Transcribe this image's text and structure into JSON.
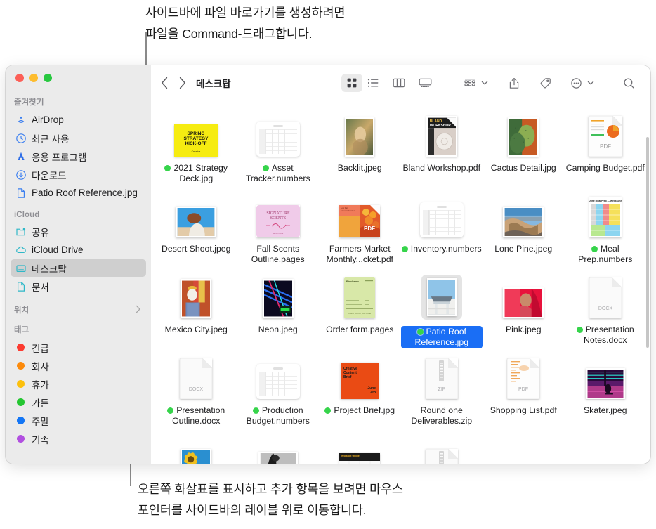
{
  "callouts": {
    "top": "사이드바에 파일 바로가기를 생성하려면\n파일을 Command-드래그합니다.",
    "bottom": "오른쪽 화살표를 표시하고 추가 항목을 보려면 마우스\n포인터를 사이드바의 레이블 위로 이동합니다."
  },
  "window": {
    "traffic_lights": [
      "close",
      "minimize",
      "zoom"
    ],
    "colors": {
      "close": "#fc5f57",
      "minimize": "#fdbc2e",
      "zoom": "#28c840",
      "selection": "#1a6ef5",
      "tag_green": "#36d44b"
    }
  },
  "toolbar": {
    "back_label": "뒤로",
    "forward_label": "앞으로",
    "title": "데스크탑",
    "views": [
      {
        "name": "icon-view",
        "label": "아이콘 보기",
        "active": true
      },
      {
        "name": "list-view",
        "label": "목록 보기",
        "active": false
      },
      {
        "name": "column-view",
        "label": "열 보기",
        "active": false
      },
      {
        "name": "gallery-view",
        "label": "갤러리 보기",
        "active": false
      }
    ],
    "group_label": "그룹 사용",
    "share_label": "공유",
    "tags_label": "태그",
    "more_label": "추가 작업",
    "search_label": "검색"
  },
  "sidebar": {
    "sections": [
      {
        "header": "즐겨찾기",
        "has_chevron": false,
        "items": [
          {
            "label": "AirDrop",
            "icon": "airdrop-icon",
            "selected": false
          },
          {
            "label": "최근 사용",
            "icon": "clock-icon",
            "selected": false
          },
          {
            "label": "응용 프로그램",
            "icon": "applications-icon",
            "selected": false
          },
          {
            "label": "다운로드",
            "icon": "downloads-icon",
            "selected": false
          },
          {
            "label": "Patio Roof Reference.jpg",
            "icon": "document-icon",
            "selected": false
          }
        ]
      },
      {
        "header": "iCloud",
        "has_chevron": false,
        "items": [
          {
            "label": "공유",
            "icon": "shared-folder-icon",
            "selected": false
          },
          {
            "label": "iCloud Drive",
            "icon": "cloud-icon",
            "selected": false
          },
          {
            "label": "데스크탑",
            "icon": "desktop-icon",
            "selected": true
          },
          {
            "label": "문서",
            "icon": "document-icon",
            "selected": false
          }
        ]
      },
      {
        "header": "위치",
        "has_chevron": true,
        "chevron": "›",
        "items": []
      },
      {
        "header": "태그",
        "has_chevron": false,
        "items": [
          {
            "label": "긴급",
            "icon": "tag-dot",
            "color": "#fc3b30",
            "selected": false
          },
          {
            "label": "회사",
            "icon": "tag-dot",
            "color": "#fc8a0b",
            "selected": false
          },
          {
            "label": "휴가",
            "icon": "tag-dot",
            "color": "#fcc00c",
            "selected": false
          },
          {
            "label": "가든",
            "icon": "tag-dot",
            "color": "#24c631",
            "selected": false
          },
          {
            "label": "주말",
            "icon": "tag-dot",
            "color": "#1476f5",
            "selected": false
          },
          {
            "label": "기족",
            "icon": "tag-dot",
            "color": "#b14fe0",
            "selected": false
          }
        ]
      }
    ]
  },
  "files": [
    {
      "name": "2021 Strategy Deck.jpg",
      "tagged": true,
      "kind": "image-yellow-deck"
    },
    {
      "name": "Asset Tracker.numbers",
      "tagged": true,
      "kind": "numbers"
    },
    {
      "name": "Backlit.jpeg",
      "tagged": false,
      "kind": "photo-backlit"
    },
    {
      "name": "Bland Workshop.pdf",
      "tagged": false,
      "kind": "pdf-bland"
    },
    {
      "name": "Cactus Detail.jpg",
      "tagged": false,
      "kind": "photo-cactus"
    },
    {
      "name": "Camping Budget.pdf",
      "tagged": false,
      "kind": "pdf-budget"
    },
    {
      "name": "Desert Shoot.jpeg",
      "tagged": false,
      "kind": "photo-desert"
    },
    {
      "name": "Fall Scents Outline.pages",
      "tagged": false,
      "kind": "pages-scents"
    },
    {
      "name": "Farmers Market Monthly...cket.pdf",
      "tagged": false,
      "kind": "pdf-farmers"
    },
    {
      "name": "Inventory.numbers",
      "tagged": true,
      "kind": "numbers"
    },
    {
      "name": "Lone Pine.jpeg",
      "tagged": false,
      "kind": "photo-lonepine"
    },
    {
      "name": "Meal Prep.numbers",
      "tagged": true,
      "kind": "numbers-meal"
    },
    {
      "name": "Mexico City.jpeg",
      "tagged": false,
      "kind": "photo-mexico"
    },
    {
      "name": "Neon.jpeg",
      "tagged": false,
      "kind": "photo-neon"
    },
    {
      "name": "Order form.pages",
      "tagged": false,
      "kind": "pages-order"
    },
    {
      "name": "Patio Roof Reference.jpg",
      "tagged": true,
      "kind": "photo-patio",
      "selected": true
    },
    {
      "name": "Pink.jpeg",
      "tagged": false,
      "kind": "photo-pink"
    },
    {
      "name": "Presentation Notes.docx",
      "tagged": true,
      "kind": "docx"
    },
    {
      "name": "Presentation Outline.docx",
      "tagged": true,
      "kind": "docx"
    },
    {
      "name": "Production Budget.numbers",
      "tagged": true,
      "kind": "numbers"
    },
    {
      "name": "Project Brief.jpg",
      "tagged": true,
      "kind": "image-orange-brief"
    },
    {
      "name": "Round one Deliverables.zip",
      "tagged": false,
      "kind": "zip"
    },
    {
      "name": "Shopping List.pdf",
      "tagged": false,
      "kind": "pdf-shopping"
    },
    {
      "name": "Skater.jpeg",
      "tagged": false,
      "kind": "photo-skater"
    },
    {
      "name": "",
      "tagged": false,
      "kind": "photo-sunflower"
    },
    {
      "name": "",
      "tagged": false,
      "kind": "photo-bw"
    },
    {
      "name": "",
      "tagged": false,
      "kind": "doc-workout"
    },
    {
      "name": "",
      "tagged": false,
      "kind": "zip"
    },
    {
      "name": "",
      "tagged": false,
      "kind": "blank"
    },
    {
      "name": "",
      "tagged": false,
      "kind": "blank"
    }
  ]
}
